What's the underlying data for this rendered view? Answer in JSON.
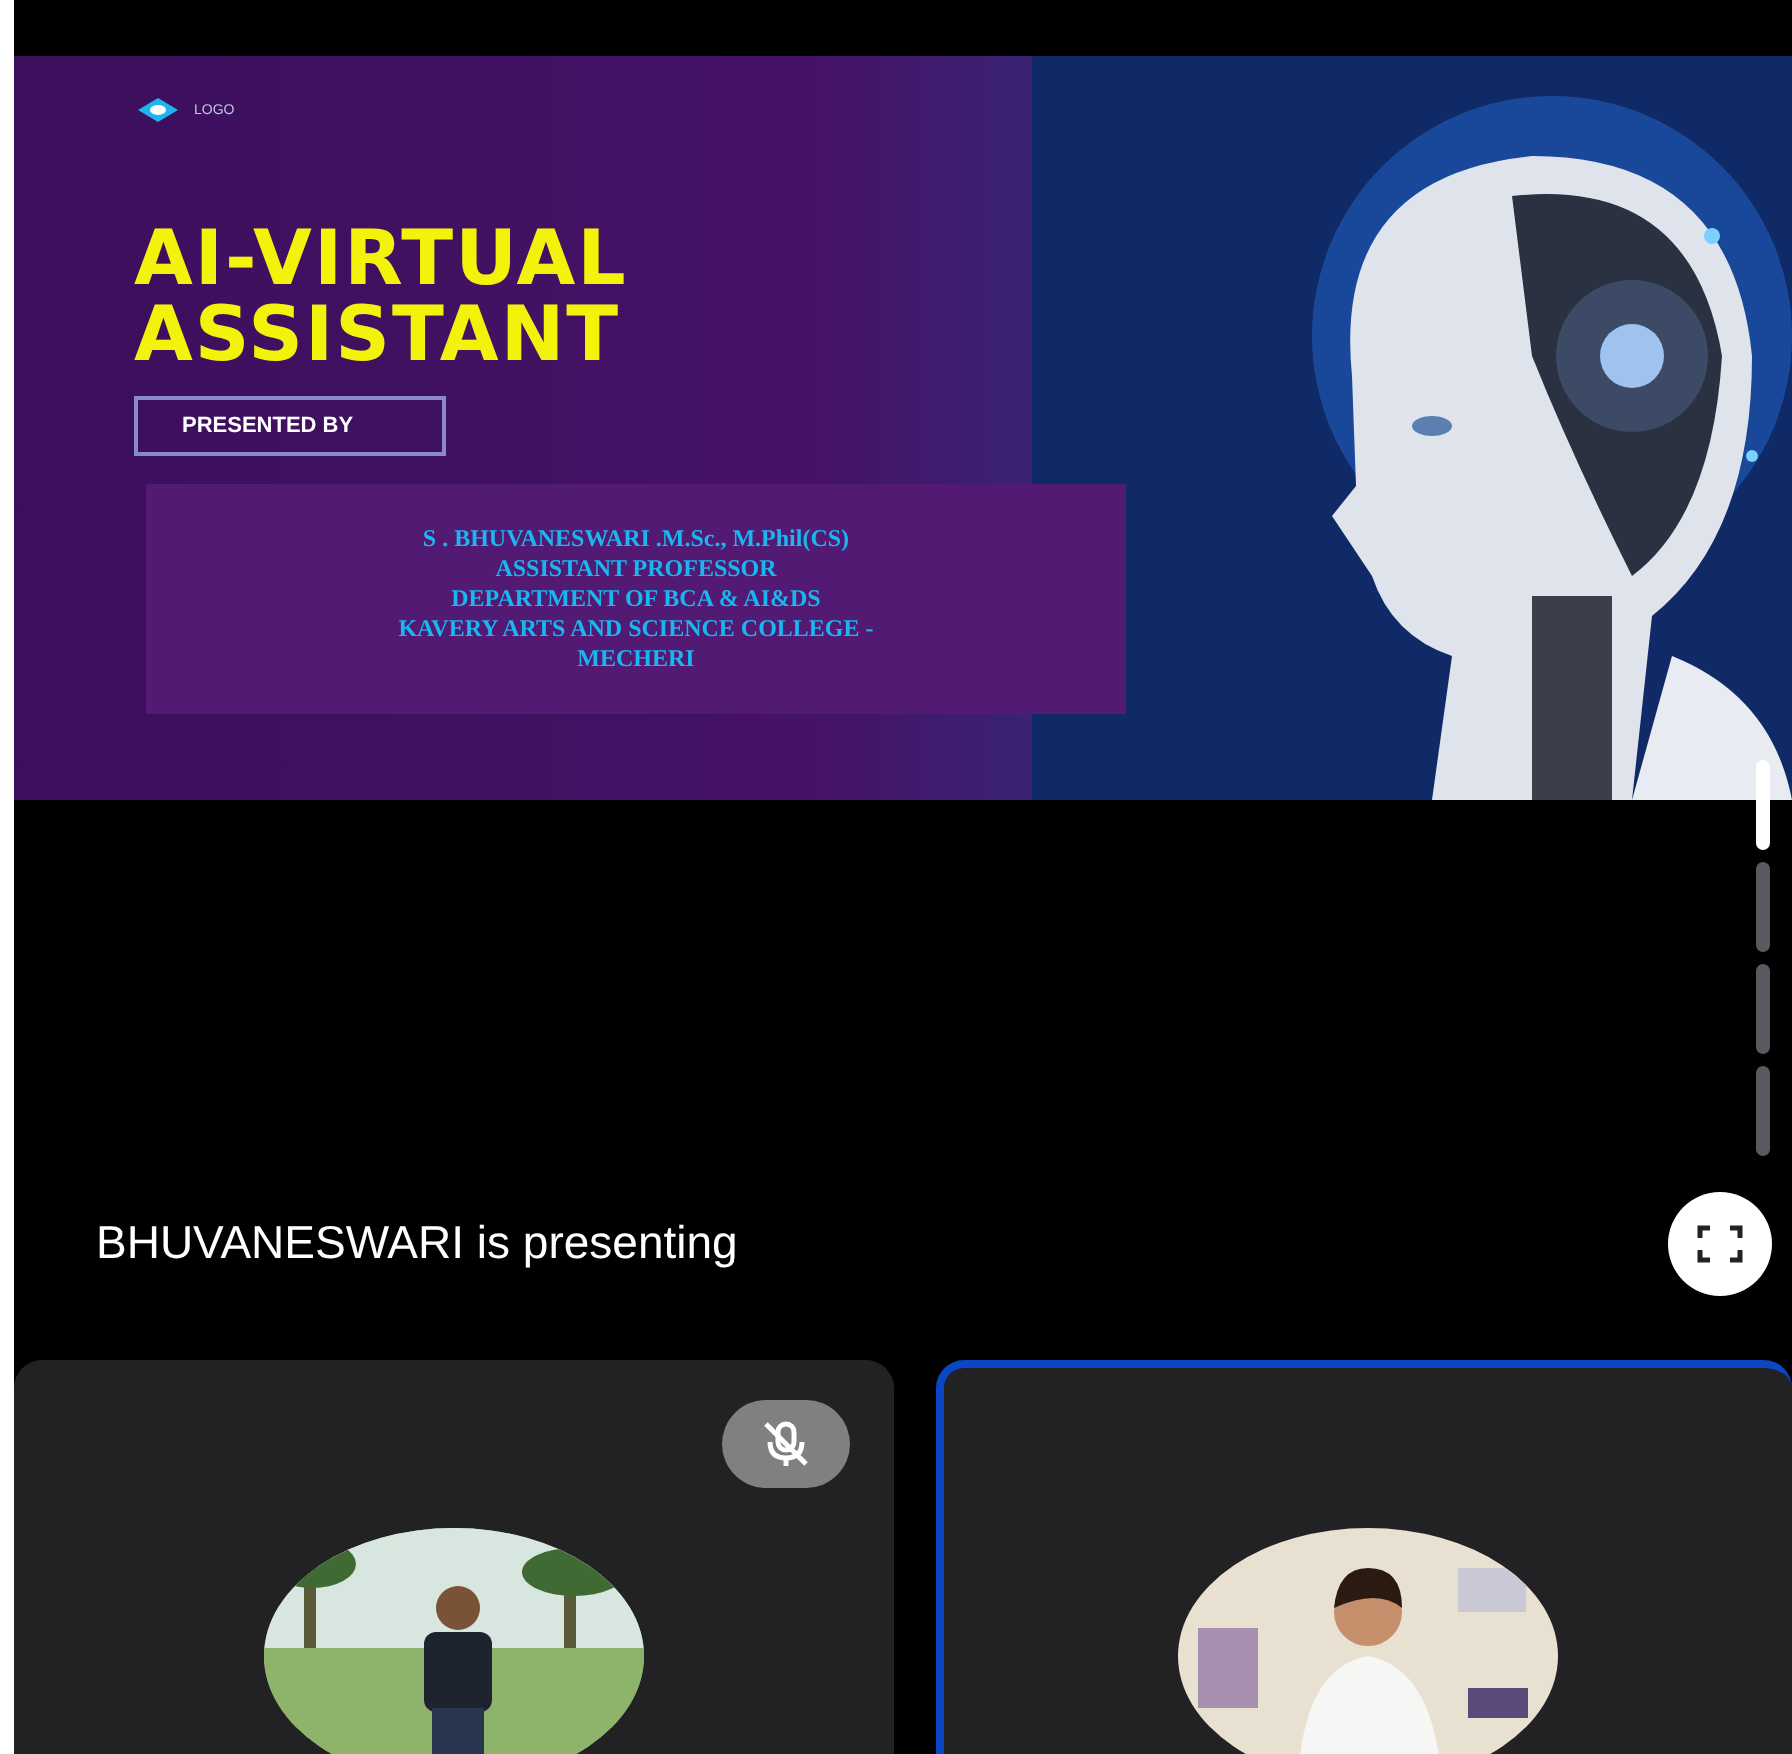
{
  "slide": {
    "logo": "LOGO",
    "title_lines": [
      "AI-VIRTUAL",
      "ASSISTANT"
    ],
    "presented_by": "PRESENTED BY",
    "presenter_lines": [
      "S . BHUVANESWARI .M.Sc., M.Phil(CS)",
      "ASSISTANT PROFESSOR",
      "DEPARTMENT OF BCA & AI&DS",
      "KAVERY ARTS AND SCIENCE COLLEGE -",
      "MECHERI"
    ]
  },
  "page_indicator": [
    {
      "selected": true
    },
    {
      "selected": false
    },
    {
      "selected": false
    },
    {
      "selected": false
    }
  ],
  "presenting_label": "BHUVANESWARI is presenting",
  "tiles": [
    {
      "muted": true,
      "highlighted": false
    },
    {
      "muted": false,
      "highlighted": true
    }
  ]
}
